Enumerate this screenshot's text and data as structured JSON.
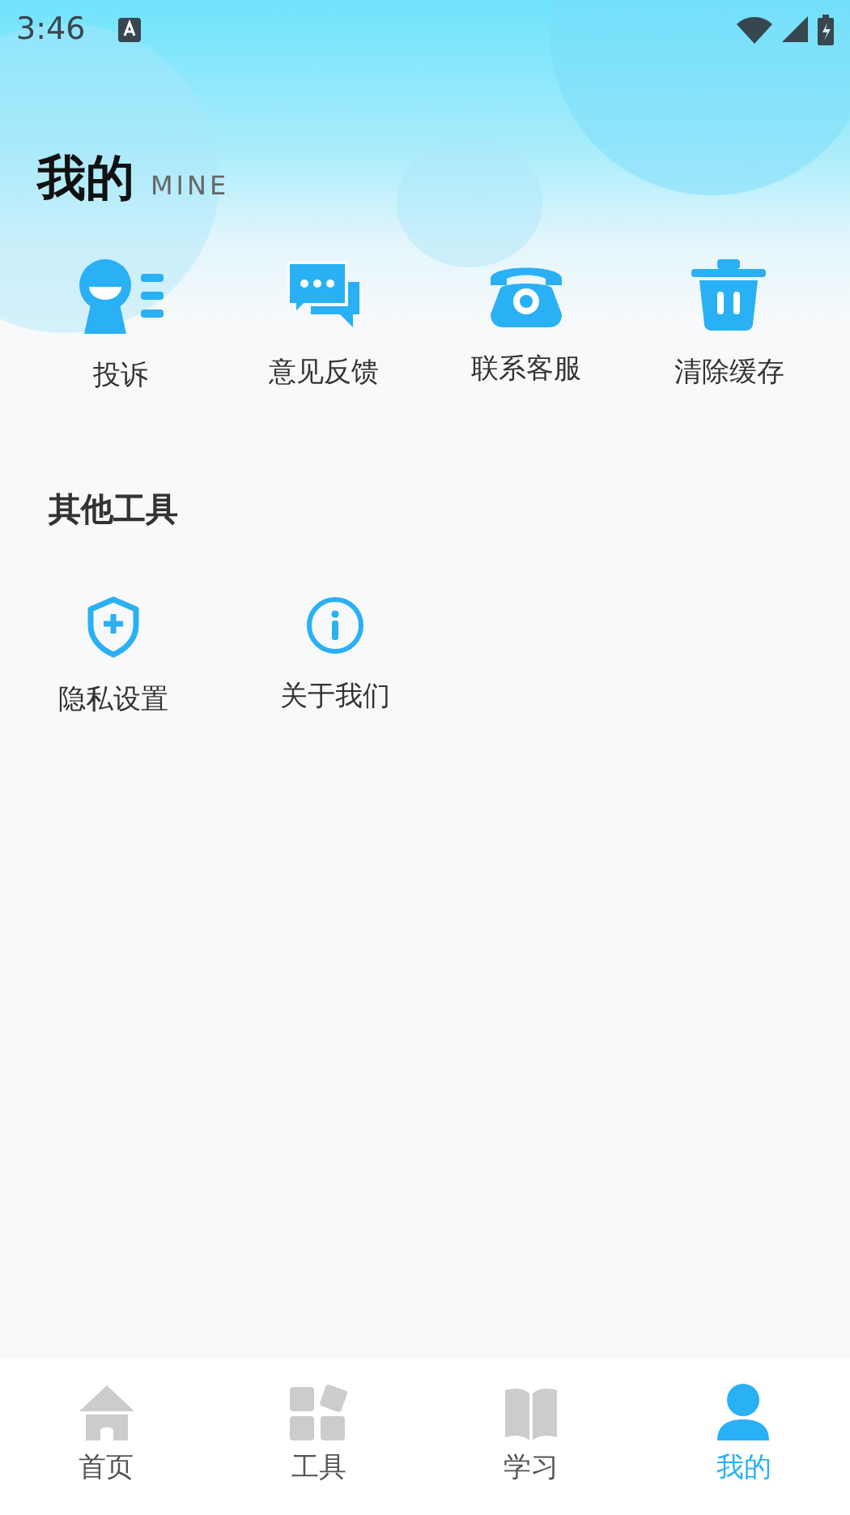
{
  "status_bar": {
    "time": "3:46"
  },
  "header": {
    "title": "我的",
    "subtitle": "MINE"
  },
  "services": [
    {
      "kind": "complaint",
      "label": "投诉"
    },
    {
      "kind": "feedback",
      "label": "意见反馈"
    },
    {
      "kind": "phone",
      "label": "联系客服"
    },
    {
      "kind": "trash",
      "label": "清除缓存"
    }
  ],
  "other_tools": {
    "title": "其他工具",
    "items": [
      {
        "kind": "shield",
        "label": "隐私设置"
      },
      {
        "kind": "info",
        "label": "关于我们"
      }
    ]
  },
  "tab_bar": [
    {
      "kind": "home",
      "label": "首页",
      "selected": false
    },
    {
      "kind": "tools",
      "label": "工具",
      "selected": false
    },
    {
      "kind": "book",
      "label": "学习",
      "selected": false
    },
    {
      "kind": "person",
      "label": "我的",
      "selected": true
    }
  ]
}
